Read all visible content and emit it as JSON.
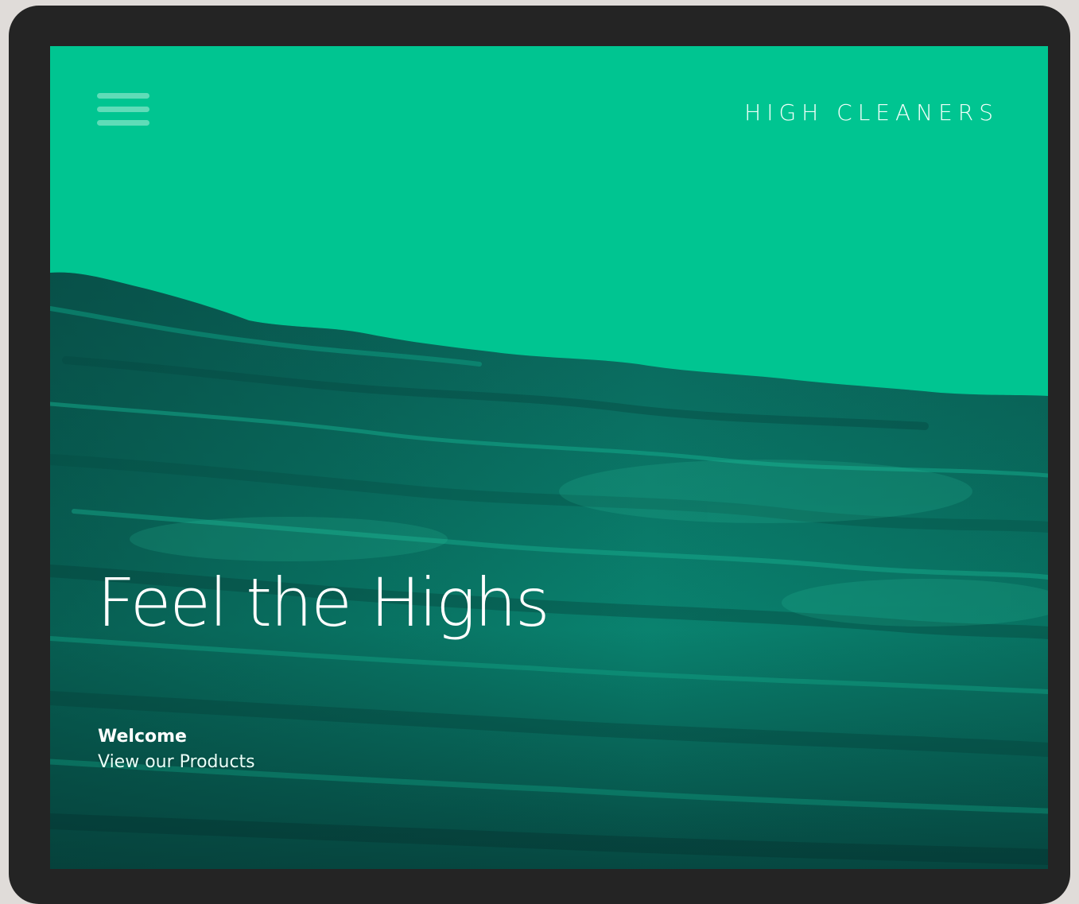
{
  "header": {
    "menu_icon": "hamburger-menu-icon",
    "brand": "HIGH CLEANERS"
  },
  "hero": {
    "title": "Feel the Highs",
    "welcome": "Welcome",
    "link_label": "View our Products"
  },
  "colors": {
    "frame": "#242424",
    "page_background": "#e0dcd9",
    "sky_green": "#00c591",
    "water_deep": "#063f3a",
    "water_mid": "#0a7d6c",
    "water_highlight": "#19a88c",
    "menu_icon": "#5fdcb8",
    "text": "#ffffff"
  }
}
